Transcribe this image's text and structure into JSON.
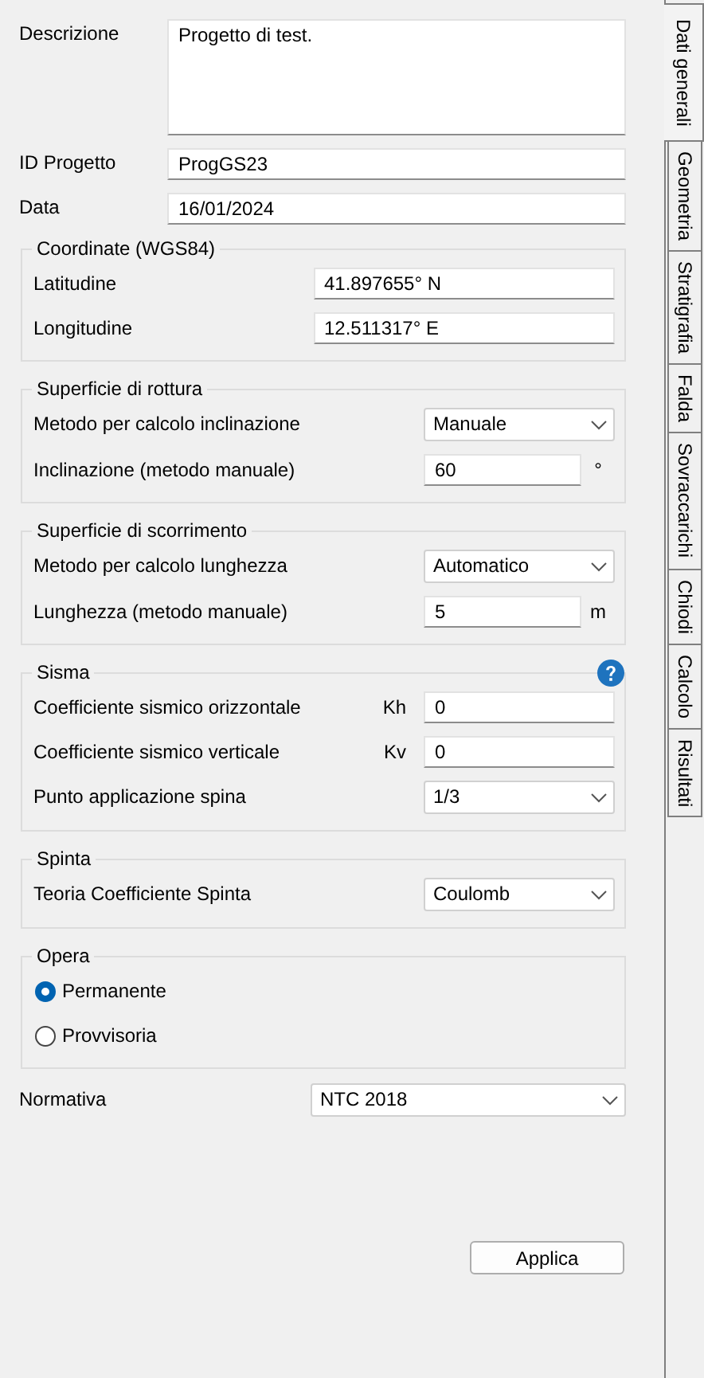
{
  "fields": [
    {
      "kind": "textarea",
      "label": "Descrizione",
      "value": "Progetto di test."
    },
    {
      "kind": "text",
      "label": "ID Progetto",
      "value": "ProgGS23"
    },
    {
      "kind": "text",
      "label": "Data",
      "value": "16/01/2024"
    }
  ],
  "groups": [
    {
      "title": "Coordinate (WGS84)",
      "help": false,
      "rows": [
        {
          "kind": "wide-text",
          "label": "Latitudine",
          "value": "41.897655° N"
        },
        {
          "kind": "wide-text",
          "label": "Longitudine",
          "value": "12.511317° E"
        }
      ]
    },
    {
      "title": "Superficie di rottura",
      "help": false,
      "rows": [
        {
          "kind": "select",
          "label": "Metodo per calcolo inclinazione",
          "value": "Manuale"
        },
        {
          "kind": "text",
          "label": "Inclinazione (metodo manuale)",
          "value": "60",
          "unit": "°"
        }
      ]
    },
    {
      "title": "Superficie di scorrimento",
      "help": false,
      "rows": [
        {
          "kind": "select",
          "label": "Metodo per calcolo lunghezza",
          "value": "Automatico"
        },
        {
          "kind": "text",
          "label": "Lunghezza (metodo manuale)",
          "value": "5",
          "unit": "m"
        }
      ]
    },
    {
      "title": "Sisma",
      "help": true,
      "rows": [
        {
          "kind": "text",
          "label": "Coefficiente sismico orizzontale",
          "symbol": "Kh",
          "value": "0"
        },
        {
          "kind": "text",
          "label": "Coefficiente sismico verticale",
          "symbol": "Kv",
          "value": "0"
        },
        {
          "kind": "select",
          "label": "Punto applicazione spina",
          "value": "1/3"
        }
      ]
    },
    {
      "title": "Spinta",
      "help": false,
      "rows": [
        {
          "kind": "select",
          "label": "Teoria Coefficiente Spinta",
          "value": "Coulomb"
        }
      ]
    },
    {
      "title": "Opera",
      "help": false,
      "rows": [
        {
          "kind": "radio",
          "label": "Permanente",
          "selected": true
        },
        {
          "kind": "radio",
          "label": "Provvisoria",
          "selected": false
        }
      ]
    }
  ],
  "normativa": {
    "label": "Normativa",
    "value": "NTC 2018"
  },
  "apply_button": "Applica",
  "tabs": [
    {
      "label": "Dati generali",
      "selected": true
    },
    {
      "label": "Geometria",
      "selected": false
    },
    {
      "label": "Stratigrafia",
      "selected": false
    },
    {
      "label": "Falda",
      "selected": false
    },
    {
      "label": "Sovraccarichi",
      "selected": false
    },
    {
      "label": "Chiodi",
      "selected": false
    },
    {
      "label": "Calcolo",
      "selected": false
    },
    {
      "label": "Risultati",
      "selected": false
    }
  ]
}
